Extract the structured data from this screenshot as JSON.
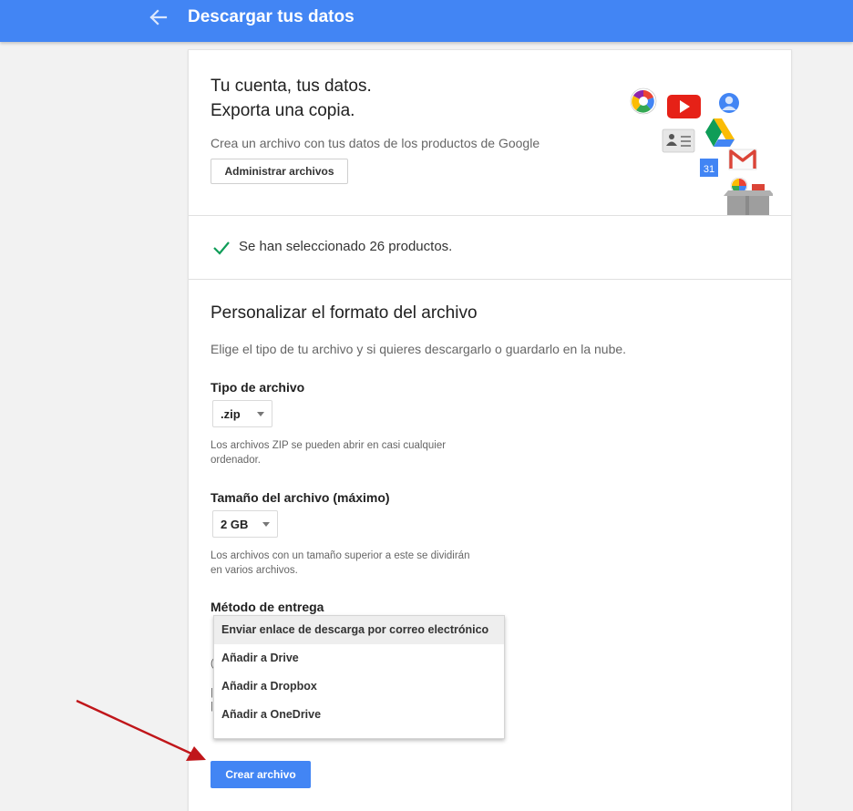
{
  "header": {
    "title": "Descargar tus datos",
    "back_icon": "arrow-left-icon",
    "color": "#4285f4"
  },
  "hero": {
    "title_line1": "Tu cuenta, tus datos.",
    "title_line2": "Exporta una copia.",
    "subtitle": "Crea un archivo con tus datos de los productos de Google",
    "manage_button": "Administrar archivos",
    "calendar_number": "31",
    "icons": [
      "photos-icon",
      "youtube-icon",
      "profile-icon",
      "drive-icon",
      "contacts-icon",
      "calendar-icon",
      "gmail-icon",
      "hangouts-icon",
      "box-icon"
    ]
  },
  "selection": {
    "text": "Se han seleccionado 26 productos.",
    "icon": "checkmark-icon",
    "color": "#0f9d58"
  },
  "format": {
    "title": "Personalizar el formato del archivo",
    "description": "Elige el tipo de tu archivo y si quieres descargarlo o guardarlo en la nube.",
    "file_type": {
      "label": "Tipo de archivo",
      "value": ".zip",
      "help": "Los archivos ZIP se pueden abrir en casi cualquier ordenador."
    },
    "file_size": {
      "label": "Tamaño del archivo (máximo)",
      "value": "2 GB",
      "help": "Los archivos con un tamaño superior a este se dividirán en varios archivos."
    },
    "delivery": {
      "label": "Método de entrega",
      "options": [
        "Enviar enlace de descarga por correo electrónico",
        "Añadir a Drive",
        "Añadir a Dropbox",
        "Añadir a OneDrive"
      ],
      "selected_index": 0
    }
  },
  "create_button": "Crear archivo",
  "annotation": {
    "arrow_color": "#c0161a"
  }
}
